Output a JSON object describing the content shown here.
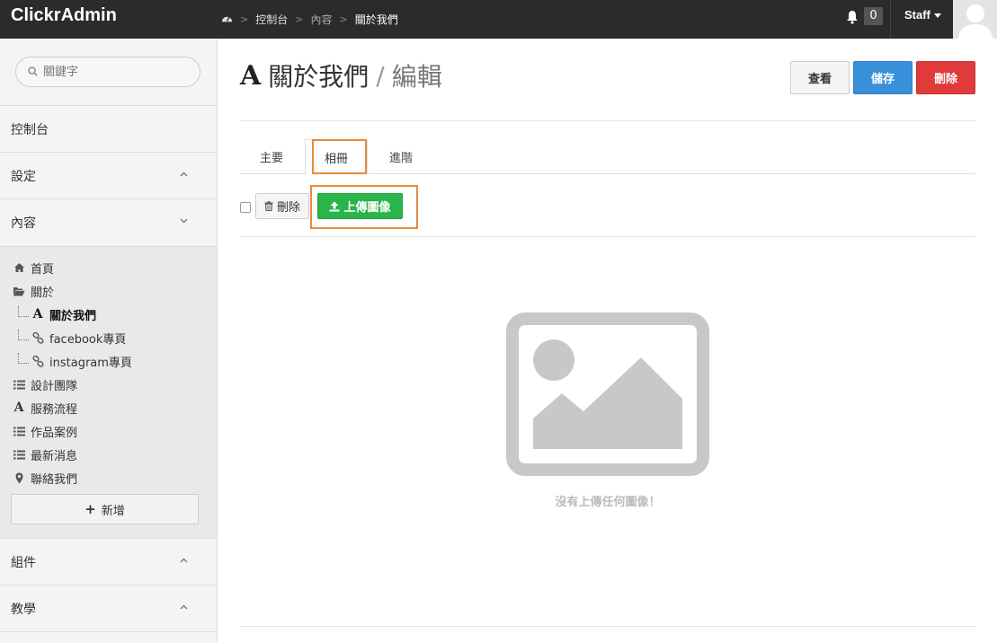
{
  "app": {
    "brand": "ClickrAdmin"
  },
  "breadcrumb": {
    "items": [
      "控制台",
      "內容",
      "關於我們"
    ]
  },
  "header": {
    "notification_count": "0",
    "user": "Staff"
  },
  "sidebar": {
    "search_placeholder": "關鍵字",
    "sections": {
      "dashboard": "控制台",
      "settings": "設定",
      "content": "內容",
      "components": "組件",
      "tutorial": "教學"
    },
    "nav": {
      "home": "首頁",
      "about": "關於",
      "about_us": "關於我們",
      "facebook": "facebook專頁",
      "instagram": "instagram專頁",
      "design_team": "設計團隊",
      "service_flow": "服務流程",
      "portfolio": "作品案例",
      "news": "最新消息",
      "contact": "聯絡我們"
    },
    "add_label": "新增"
  },
  "page": {
    "title": "關於我們",
    "subtitle": "編輯",
    "buttons": {
      "view": "查看",
      "save": "儲存",
      "delete": "刪除"
    }
  },
  "tabs": {
    "main": "主要",
    "album": "相冊",
    "advanced": "進階"
  },
  "album": {
    "remove_label": "刪除",
    "upload_label": "上傳圖像",
    "empty_text": "沒有上傳任何圖像！"
  },
  "colors": {
    "topbar": "#2b2b2b",
    "save": "#3a8fd9",
    "delete": "#e03a3a",
    "upload": "#2ab44a",
    "highlight": "#e8893a"
  }
}
